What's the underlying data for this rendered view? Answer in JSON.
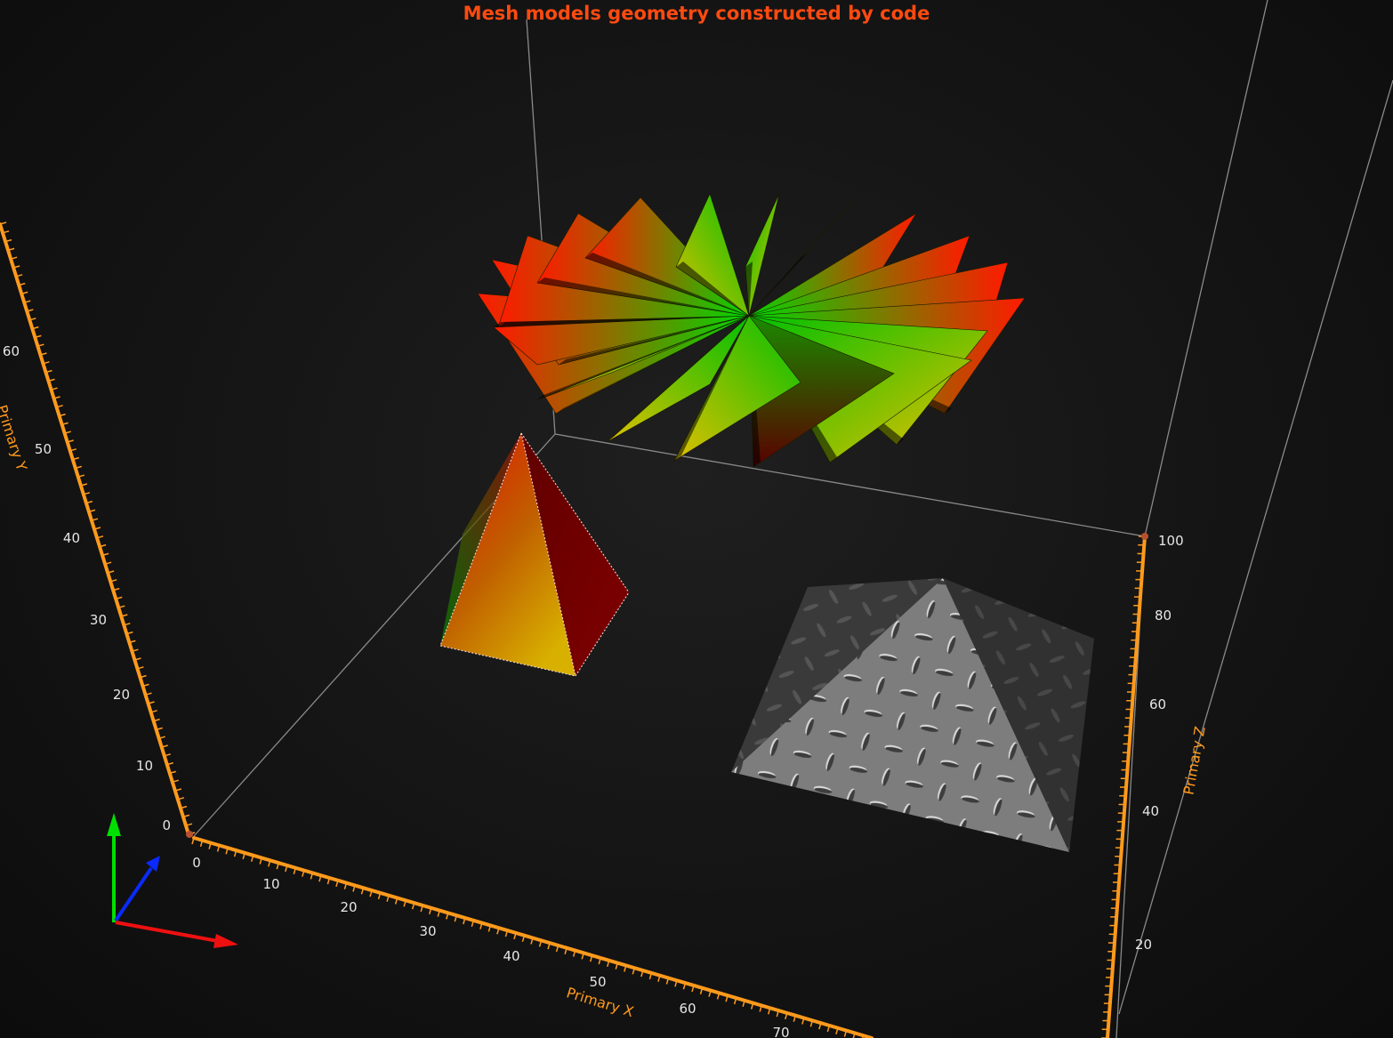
{
  "chart_data": {
    "type": "mesh3d",
    "title": "Mesh models geometry constructed by code",
    "axes": {
      "x": {
        "label": "Primary X",
        "ticks": [
          0,
          10,
          20,
          30,
          40,
          50,
          60,
          70
        ]
      },
      "y": {
        "label": "Primary Y",
        "ticks": [
          0,
          10,
          20,
          30,
          40,
          50,
          60
        ]
      },
      "z": {
        "label": "Primary Z",
        "ticks": [
          20,
          40,
          60,
          80,
          100
        ]
      }
    },
    "meshes": [
      {
        "name": "fan-of-triangles",
        "colors": [
          "#ff1a00",
          "#00e000",
          "#d4b000"
        ]
      },
      {
        "name": "gradient-pyramid",
        "colors": [
          "#e01000",
          "#00a000",
          "#e0c000"
        ]
      },
      {
        "name": "textured-pyramid",
        "colors": [
          "#9a9a9a",
          "#3a3a3a"
        ]
      }
    ],
    "colors": {
      "title": "#ff4a10",
      "axis": "#ff9a1c",
      "frame": "#8a8a8a",
      "tick_label": "#e6e6e6"
    }
  }
}
